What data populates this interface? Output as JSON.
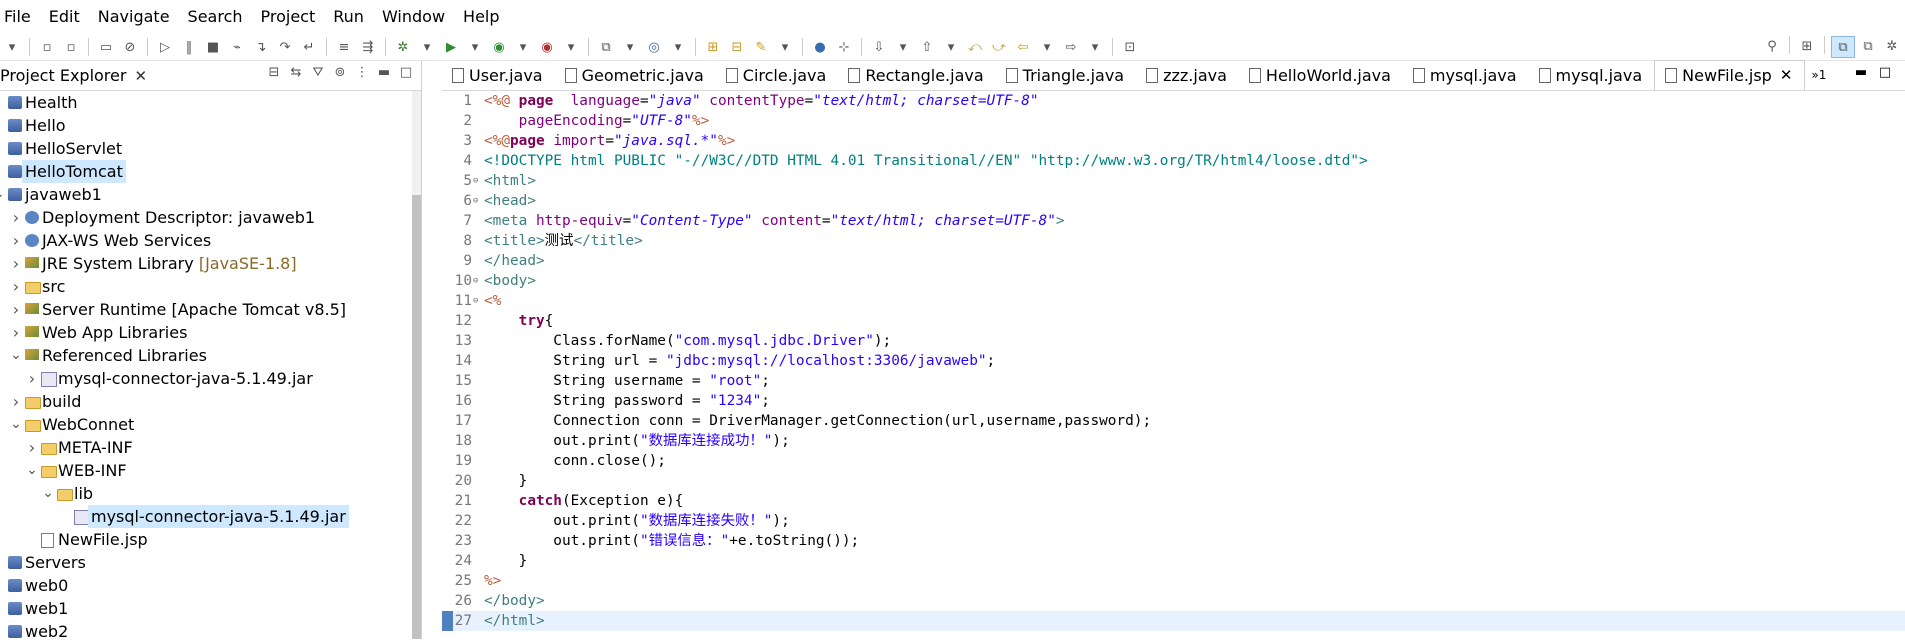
{
  "menu": [
    "File",
    "Edit",
    "Navigate",
    "Search",
    "Project",
    "Run",
    "Window",
    "Help"
  ],
  "explorer": {
    "title": "Project Explorer",
    "items": [
      {
        "label": "Health",
        "indent": 0,
        "arrow": "",
        "icon": "proj"
      },
      {
        "label": "Hello",
        "indent": 0,
        "arrow": "",
        "icon": "proj"
      },
      {
        "label": "HelloServlet",
        "indent": 0,
        "arrow": "",
        "icon": "proj"
      },
      {
        "label": "HelloTomcat",
        "indent": 0,
        "arrow": "",
        "icon": "proj",
        "selected": true
      },
      {
        "label": "javaweb1",
        "indent": 0,
        "arrow": "v",
        "icon": "proj"
      },
      {
        "label": "Deployment Descriptor: javaweb1",
        "indent": 1,
        "arrow": ">",
        "icon": "gear"
      },
      {
        "label": "JAX-WS Web Services",
        "indent": 1,
        "arrow": ">",
        "icon": "gear"
      },
      {
        "label": "JRE System Library",
        "decoration": "[JavaSE-1.8]",
        "indent": 1,
        "arrow": ">",
        "icon": "lib"
      },
      {
        "label": "src",
        "indent": 1,
        "arrow": ">",
        "icon": "folder"
      },
      {
        "label": "Server Runtime [Apache Tomcat v8.5]",
        "indent": 1,
        "arrow": ">",
        "icon": "lib"
      },
      {
        "label": "Web App Libraries",
        "indent": 1,
        "arrow": ">",
        "icon": "lib"
      },
      {
        "label": "Referenced Libraries",
        "indent": 1,
        "arrow": "v",
        "icon": "lib"
      },
      {
        "label": "mysql-connector-java-5.1.49.jar",
        "indent": 2,
        "arrow": ">",
        "icon": "jar"
      },
      {
        "label": "build",
        "indent": 1,
        "arrow": ">",
        "icon": "folder"
      },
      {
        "label": "WebConnet",
        "indent": 1,
        "arrow": "v",
        "icon": "folder"
      },
      {
        "label": "META-INF",
        "indent": 2,
        "arrow": ">",
        "icon": "folder"
      },
      {
        "label": "WEB-INF",
        "indent": 2,
        "arrow": "v",
        "icon": "folder"
      },
      {
        "label": "lib",
        "indent": 3,
        "arrow": "v",
        "icon": "folder"
      },
      {
        "label": "mysql-connector-java-5.1.49.jar",
        "indent": 4,
        "arrow": "",
        "icon": "jar",
        "selected": true
      },
      {
        "label": "NewFile.jsp",
        "indent": 2,
        "arrow": "",
        "icon": "file"
      },
      {
        "label": "Servers",
        "indent": 0,
        "arrow": "",
        "icon": "proj"
      },
      {
        "label": "web0",
        "indent": 0,
        "arrow": "",
        "icon": "proj"
      },
      {
        "label": "web1",
        "indent": 0,
        "arrow": "",
        "icon": "proj"
      },
      {
        "label": "web2",
        "indent": 0,
        "arrow": "",
        "icon": "proj"
      }
    ]
  },
  "editor": {
    "tabs": [
      "User.java",
      "Geometric.java",
      "Circle.java",
      "Rectangle.java",
      "Triangle.java",
      "zzz.java",
      "HelloWorld.java",
      "mysql.java",
      "mysql.java",
      "NewFile.jsp"
    ],
    "active_tab": "NewFile.jsp",
    "overflow": "»1",
    "current_line": 27,
    "lines": [
      {
        "n": "1",
        "fold": "",
        "t": [
          [
            "dlm",
            "<%@ "
          ],
          [
            "k",
            "page"
          ],
          [
            "",
            "  "
          ],
          [
            "at",
            "language"
          ],
          [
            "",
            "="
          ],
          [
            "av",
            "\"java\""
          ],
          [
            "",
            " "
          ],
          [
            "at",
            "contentType"
          ],
          [
            "",
            "="
          ],
          [
            "av",
            "\"text/html; charset=UTF-8\""
          ]
        ]
      },
      {
        "n": "2",
        "fold": "",
        "t": [
          [
            "",
            "    "
          ],
          [
            "at",
            "pageEncoding"
          ],
          [
            "",
            "="
          ],
          [
            "av",
            "\"UTF-8\""
          ],
          [
            "dlm",
            "%>"
          ]
        ]
      },
      {
        "n": "3",
        "fold": "",
        "t": [
          [
            "dlm",
            "<%@"
          ],
          [
            "k",
            "page"
          ],
          [
            "",
            " "
          ],
          [
            "at",
            "import"
          ],
          [
            "",
            "="
          ],
          [
            "av",
            "\"java.sql.*\""
          ],
          [
            "dlm",
            "%>"
          ]
        ]
      },
      {
        "n": "4",
        "fold": "",
        "t": [
          [
            "dt",
            "<!DOCTYPE html PUBLIC \"-//W3C//DTD HTML 4.01 Transitional//EN\" \"http://www.w3.org/TR/html4/loose.dtd\">"
          ]
        ]
      },
      {
        "n": "5",
        "fold": "⊖",
        "t": [
          [
            "tag",
            "<html>"
          ]
        ]
      },
      {
        "n": "6",
        "fold": "⊖",
        "t": [
          [
            "tag",
            "<head>"
          ]
        ]
      },
      {
        "n": "7",
        "fold": "",
        "t": [
          [
            "tag",
            "<meta "
          ],
          [
            "at",
            "http-equiv"
          ],
          [
            "",
            "="
          ],
          [
            "av",
            "\"Content-Type\""
          ],
          [
            "",
            " "
          ],
          [
            "at",
            "content"
          ],
          [
            "",
            "="
          ],
          [
            "av",
            "\"text/html; charset=UTF-8\""
          ],
          [
            "tag",
            ">"
          ]
        ]
      },
      {
        "n": "8",
        "fold": "",
        "t": [
          [
            "tag",
            "<title>"
          ],
          [
            "",
            "测试"
          ],
          [
            "tag",
            "</title>"
          ]
        ]
      },
      {
        "n": "9",
        "fold": "",
        "t": [
          [
            "tag",
            "</head>"
          ]
        ]
      },
      {
        "n": "10",
        "fold": "⊖",
        "t": [
          [
            "tag",
            "<body>"
          ]
        ]
      },
      {
        "n": "11",
        "fold": "⊖",
        "t": [
          [
            "dlm",
            "<%"
          ]
        ]
      },
      {
        "n": "12",
        "fold": "",
        "t": [
          [
            "",
            "    "
          ],
          [
            "k",
            "try"
          ],
          [
            "",
            "{"
          ]
        ]
      },
      {
        "n": "13",
        "fold": "",
        "t": [
          [
            "",
            "        Class.forName("
          ],
          [
            "str",
            "\"com.mysql.jdbc.Driver\""
          ],
          [
            "",
            ");"
          ]
        ]
      },
      {
        "n": "14",
        "fold": "",
        "t": [
          [
            "",
            "        String url = "
          ],
          [
            "str",
            "\"jdbc:mysql://localhost:3306/javaweb\""
          ],
          [
            "",
            ";"
          ]
        ]
      },
      {
        "n": "15",
        "fold": "",
        "t": [
          [
            "",
            "        String username = "
          ],
          [
            "str",
            "\"root\""
          ],
          [
            "",
            ";"
          ]
        ]
      },
      {
        "n": "16",
        "fold": "",
        "t": [
          [
            "",
            "        String password = "
          ],
          [
            "str",
            "\"1234\""
          ],
          [
            "",
            ";"
          ]
        ]
      },
      {
        "n": "17",
        "fold": "",
        "t": [
          [
            "",
            "        Connection conn = DriverManager.getConnection(url,username,password);"
          ]
        ]
      },
      {
        "n": "18",
        "fold": "",
        "t": [
          [
            "",
            "        out.print("
          ],
          [
            "str",
            "\"数据库连接成功！\""
          ],
          [
            "",
            ");"
          ]
        ]
      },
      {
        "n": "19",
        "fold": "",
        "t": [
          [
            "",
            "        conn.close();"
          ]
        ]
      },
      {
        "n": "20",
        "fold": "",
        "t": [
          [
            "",
            "    }"
          ]
        ]
      },
      {
        "n": "21",
        "fold": "",
        "t": [
          [
            "",
            "    "
          ],
          [
            "k",
            "catch"
          ],
          [
            "",
            "(Exception e){"
          ]
        ]
      },
      {
        "n": "22",
        "fold": "",
        "t": [
          [
            "",
            "        out.print("
          ],
          [
            "str",
            "\"数据库连接失败！\""
          ],
          [
            "",
            ");"
          ]
        ]
      },
      {
        "n": "23",
        "fold": "",
        "t": [
          [
            "",
            "        out.print("
          ],
          [
            "str",
            "\"错误信息：\""
          ],
          [
            "",
            "+e.toString());"
          ]
        ]
      },
      {
        "n": "24",
        "fold": "",
        "t": [
          [
            "",
            "    }"
          ]
        ]
      },
      {
        "n": "25",
        "fold": "",
        "t": [
          [
            "dlm",
            "%>"
          ]
        ]
      },
      {
        "n": "26",
        "fold": "",
        "t": [
          [
            "tag",
            "</body>"
          ]
        ]
      },
      {
        "n": "27",
        "fold": "",
        "t": [
          [
            "tag",
            "</html>"
          ]
        ]
      }
    ]
  }
}
